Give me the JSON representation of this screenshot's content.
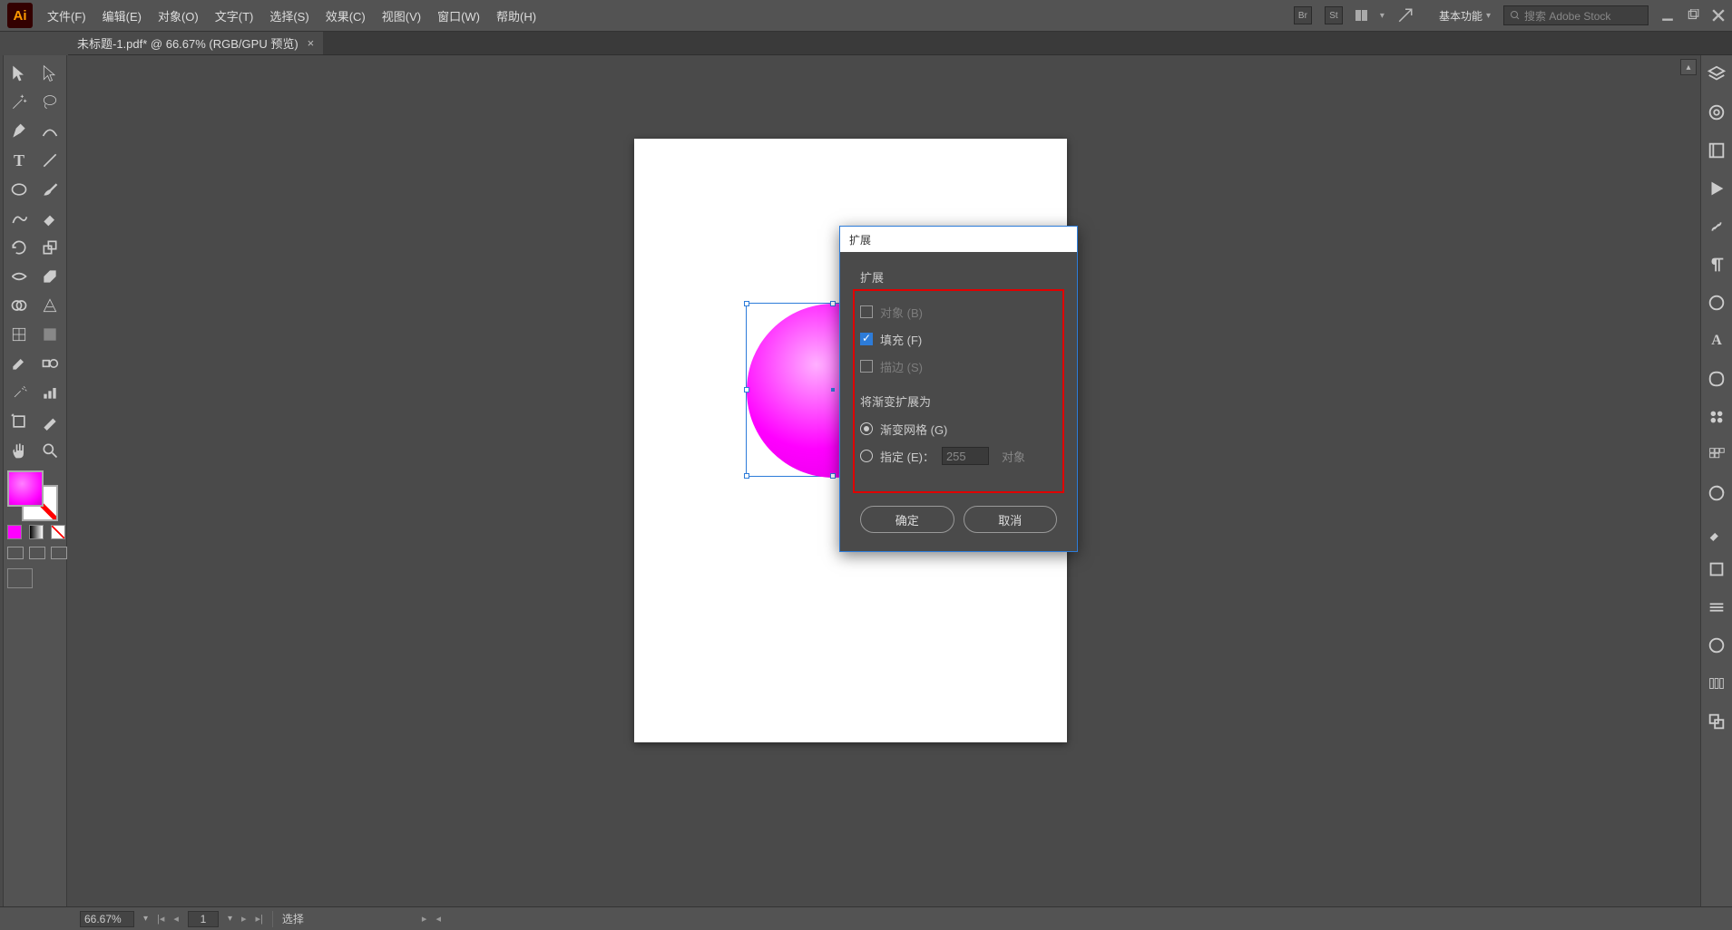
{
  "app_logo": "Ai",
  "menu": [
    "文件(F)",
    "编辑(E)",
    "对象(O)",
    "文字(T)",
    "选择(S)",
    "效果(C)",
    "视图(V)",
    "窗口(W)",
    "帮助(H)"
  ],
  "top_icons": {
    "br": "Br",
    "st": "St"
  },
  "workspace_label": "基本功能",
  "search_placeholder": "搜索 Adobe Stock",
  "doc_tab": {
    "title": "未标题-1.pdf* @ 66.67% (RGB/GPU 预览)"
  },
  "zoom_value": "66.67%",
  "page_value": "1",
  "status_tool": "选择",
  "dialog": {
    "title": "扩展",
    "section_expand_label": "扩展",
    "opt_object": "对象 (B)",
    "opt_fill": "填充 (F)",
    "opt_stroke": "描边 (S)",
    "section_expandto_label": "将渐变扩展为",
    "opt_gradient_mesh": "渐变网格 (G)",
    "opt_specify": "指定 (E)：",
    "specify_value": "255",
    "specify_unit": "对象",
    "btn_ok": "确定",
    "btn_cancel": "取消"
  },
  "tools": [
    [
      "selection",
      "direct-selection"
    ],
    [
      "magic-wand",
      "lasso"
    ],
    [
      "pen",
      "curvature"
    ],
    [
      "type",
      "line"
    ],
    [
      "rect",
      "brush"
    ],
    [
      "shaper",
      "eraser"
    ],
    [
      "rotate",
      "scale"
    ],
    [
      "width",
      "free-transform"
    ],
    [
      "shape-builder",
      "perspective"
    ],
    [
      "mesh",
      "gradient"
    ],
    [
      "eyedropper",
      "blend"
    ],
    [
      "symbol-sprayer",
      "graph"
    ],
    [
      "artboard",
      "slice"
    ],
    [
      "hand",
      "zoom"
    ]
  ],
  "right_rail_icons": [
    "layers",
    "cc-libraries",
    "properties",
    "play",
    "link",
    "glyphs",
    "appearance",
    "char",
    "infinity",
    "graphic-styles",
    "swatches",
    "brushes",
    "symbols",
    "stroke",
    "transparency",
    "gradient",
    "align",
    "pathfinder"
  ]
}
